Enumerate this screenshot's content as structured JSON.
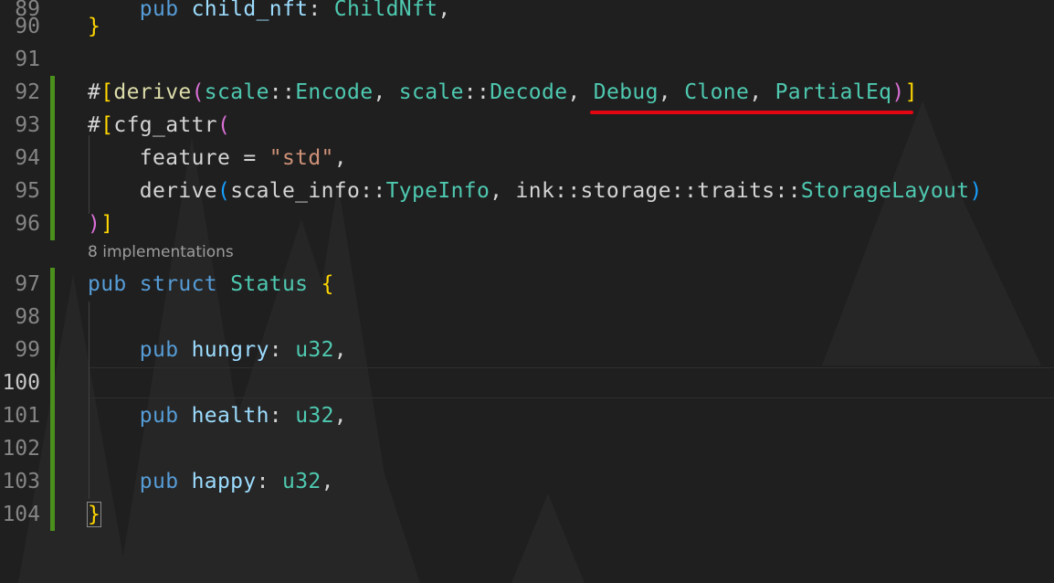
{
  "editor": {
    "colors": {
      "background": "#1f1f1f",
      "keyword": "#569cd6",
      "type": "#4ec9b0",
      "field": "#9cdcfe",
      "string": "#ce9178",
      "bracket_gold": "#ffd700",
      "bracket_purple": "#da70d6",
      "bracket_blue": "#179fff",
      "gutter_modified": "#4b8f1d",
      "annotation_underline": "#e30613"
    },
    "codelens": "8 implementations",
    "active_line": "100",
    "lines": [
      {
        "num": "89",
        "tokens": [
          {
            "t": "    ",
            "c": "text"
          },
          {
            "t": "pub",
            "c": "kw"
          },
          {
            "t": " ",
            "c": "text"
          },
          {
            "t": "child_nft",
            "c": "field"
          },
          {
            "t": ": ",
            "c": "text"
          },
          {
            "t": "ChildNft",
            "c": "type"
          },
          {
            "t": ",",
            "c": "text"
          }
        ]
      },
      {
        "num": "90",
        "tokens": [
          {
            "t": "}",
            "c": "br1"
          }
        ]
      },
      {
        "num": "91",
        "tokens": []
      },
      {
        "num": "92",
        "tokens": [
          {
            "t": "#",
            "c": "text"
          },
          {
            "t": "[",
            "c": "br1"
          },
          {
            "t": "derive",
            "c": "attr"
          },
          {
            "t": "(",
            "c": "br2"
          },
          {
            "t": "scale",
            "c": "type"
          },
          {
            "t": "::",
            "c": "text"
          },
          {
            "t": "Encode",
            "c": "type"
          },
          {
            "t": ", ",
            "c": "text"
          },
          {
            "t": "scale",
            "c": "type"
          },
          {
            "t": "::",
            "c": "text"
          },
          {
            "t": "Decode",
            "c": "type"
          },
          {
            "t": ", ",
            "c": "text"
          },
          {
            "t": "Debug",
            "c": "type"
          },
          {
            "t": ", ",
            "c": "text"
          },
          {
            "t": "Clone",
            "c": "type"
          },
          {
            "t": ", ",
            "c": "text"
          },
          {
            "t": "PartialEq",
            "c": "type"
          },
          {
            "t": ")",
            "c": "br2"
          },
          {
            "t": "]",
            "c": "br1"
          }
        ]
      },
      {
        "num": "93",
        "tokens": [
          {
            "t": "#",
            "c": "text"
          },
          {
            "t": "[",
            "c": "br1"
          },
          {
            "t": "cfg_attr",
            "c": "text"
          },
          {
            "t": "(",
            "c": "br2"
          }
        ]
      },
      {
        "num": "94",
        "tokens": [
          {
            "t": "    feature = ",
            "c": "text"
          },
          {
            "t": "\"std\"",
            "c": "str"
          },
          {
            "t": ",",
            "c": "text"
          }
        ]
      },
      {
        "num": "95",
        "tokens": [
          {
            "t": "    derive",
            "c": "text"
          },
          {
            "t": "(",
            "c": "br3"
          },
          {
            "t": "scale_info",
            "c": "text"
          },
          {
            "t": "::",
            "c": "text"
          },
          {
            "t": "TypeInfo",
            "c": "type"
          },
          {
            "t": ", ink::storage::traits::",
            "c": "text"
          },
          {
            "t": "StorageLayout",
            "c": "type"
          },
          {
            "t": ")",
            "c": "br3"
          }
        ]
      },
      {
        "num": "96",
        "tokens": [
          {
            "t": ")",
            "c": "br2"
          },
          {
            "t": "]",
            "c": "br1"
          }
        ]
      },
      {
        "num": "97",
        "tokens": [
          {
            "t": "pub",
            "c": "kw"
          },
          {
            "t": " ",
            "c": "text"
          },
          {
            "t": "struct",
            "c": "kw"
          },
          {
            "t": " ",
            "c": "text"
          },
          {
            "t": "Status",
            "c": "type"
          },
          {
            "t": " ",
            "c": "text"
          },
          {
            "t": "{",
            "c": "br1"
          }
        ]
      },
      {
        "num": "98",
        "tokens": []
      },
      {
        "num": "99",
        "tokens": [
          {
            "t": "    ",
            "c": "text"
          },
          {
            "t": "pub",
            "c": "kw"
          },
          {
            "t": " ",
            "c": "text"
          },
          {
            "t": "hungry",
            "c": "field"
          },
          {
            "t": ": ",
            "c": "text"
          },
          {
            "t": "u32",
            "c": "type"
          },
          {
            "t": ",",
            "c": "text"
          }
        ]
      },
      {
        "num": "100",
        "tokens": []
      },
      {
        "num": "101",
        "tokens": [
          {
            "t": "    ",
            "c": "text"
          },
          {
            "t": "pub",
            "c": "kw"
          },
          {
            "t": " ",
            "c": "text"
          },
          {
            "t": "health",
            "c": "field"
          },
          {
            "t": ": ",
            "c": "text"
          },
          {
            "t": "u32",
            "c": "type"
          },
          {
            "t": ",",
            "c": "text"
          }
        ]
      },
      {
        "num": "102",
        "tokens": []
      },
      {
        "num": "103",
        "tokens": [
          {
            "t": "    ",
            "c": "text"
          },
          {
            "t": "pub",
            "c": "kw"
          },
          {
            "t": " ",
            "c": "text"
          },
          {
            "t": "happy",
            "c": "field"
          },
          {
            "t": ": ",
            "c": "text"
          },
          {
            "t": "u32",
            "c": "type"
          },
          {
            "t": ",",
            "c": "text"
          }
        ]
      },
      {
        "num": "104",
        "tokens": [
          {
            "t": "}",
            "c": "br1"
          }
        ]
      }
    ]
  }
}
